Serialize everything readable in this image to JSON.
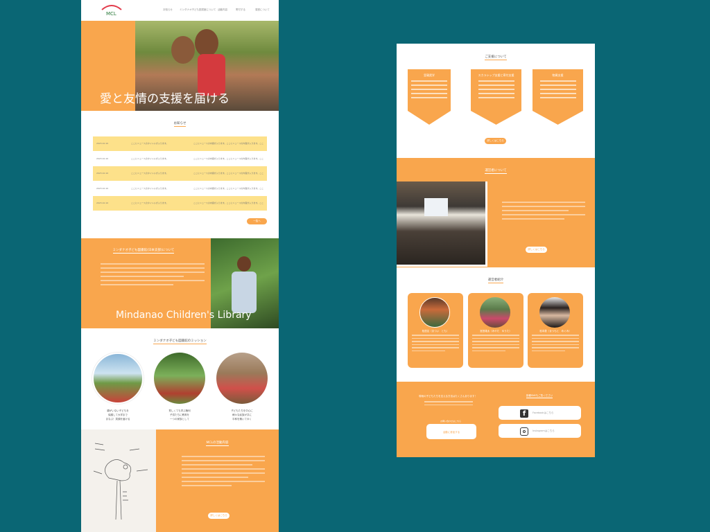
{
  "nav": {
    "logo": "MCL",
    "items": [
      "お知らせ",
      "ミンダナオ子ども図書館について",
      "活動内容",
      "寄付する",
      "運営について"
    ]
  },
  "hero": {
    "title": "愛と友情の支援を届ける"
  },
  "news": {
    "title": "お知らせ",
    "rows": [
      {
        "date": "2023.10.10",
        "a": "ここにニュースのタイトルが入ります。",
        "b": "ここにニュースの内容が入ります。ここにニュースの内容が入ります。ここ"
      },
      {
        "date": "2023.10.10",
        "a": "ここにニュースのタイトルが入ります。",
        "b": "ここにニュースの内容が入ります。ここにニュースの内容が入ります。ここ"
      },
      {
        "date": "2023.10.10",
        "a": "ここにニュースのタイトルが入ります。",
        "b": "ここにニュースの内容が入ります。ここにニュースの内容が入ります。ここ"
      },
      {
        "date": "2023.10.10",
        "a": "ここにニュースのタイトルが入ります。",
        "b": "ここにニュースの内容が入ります。ここにニュースの内容が入ります。ここ"
      },
      {
        "date": "2023.10.10",
        "a": "ここにニュースのタイトルが入ります。",
        "b": "ここにニュースの内容が入ります。ここにニュースの内容が入ります。ここ"
      }
    ],
    "more": "一覧へ"
  },
  "about": {
    "title": "ミンダナオ子ども図書館(日本支部)について",
    "big": "Mindanao Children's Library"
  },
  "mission": {
    "title": "ミンダナオ子ども図書館のミッション",
    "items": [
      {
        "t1": "親がいない子どもを",
        "t2": "保護して大学まで",
        "t3": "まなぶ！笑顔を届ける"
      },
      {
        "t1": "貧しくても学ぶ権利",
        "t2": "子供たちに教育を",
        "t3": "一つの家族として"
      },
      {
        "t1": "子どもたちを中心に",
        "t2": "様々な民族が共に",
        "t3": "平和を築いてゆく"
      }
    ]
  },
  "activity": {
    "title": "MCLの活動内容",
    "more": "詳しくはこちら"
  },
  "support": {
    "title": "ご支援について",
    "cards": [
      "里親奨学",
      "スカラシップ支援と寄付支援",
      "物資支援"
    ],
    "more": "詳しくはこちら"
  },
  "operators": {
    "title": "運営者について",
    "more": "詳しくはこちら"
  },
  "members": {
    "title": "運営者紹介",
    "names": [
      "松居友（まつい　とも）",
      "宮田雄太（みやた　ゆうた）",
      "松本恵（まつもと　めぐみ）"
    ]
  },
  "footer": {
    "left": "現地の子どもたちを支える方法はたくさんあります！",
    "cta": "活動に参加する",
    "contact": "お問い合わせはこちら",
    "sns": "各種SNSもご覧ください",
    "fb": "Facebookはこちら",
    "ig": "Instagramはこちら"
  }
}
